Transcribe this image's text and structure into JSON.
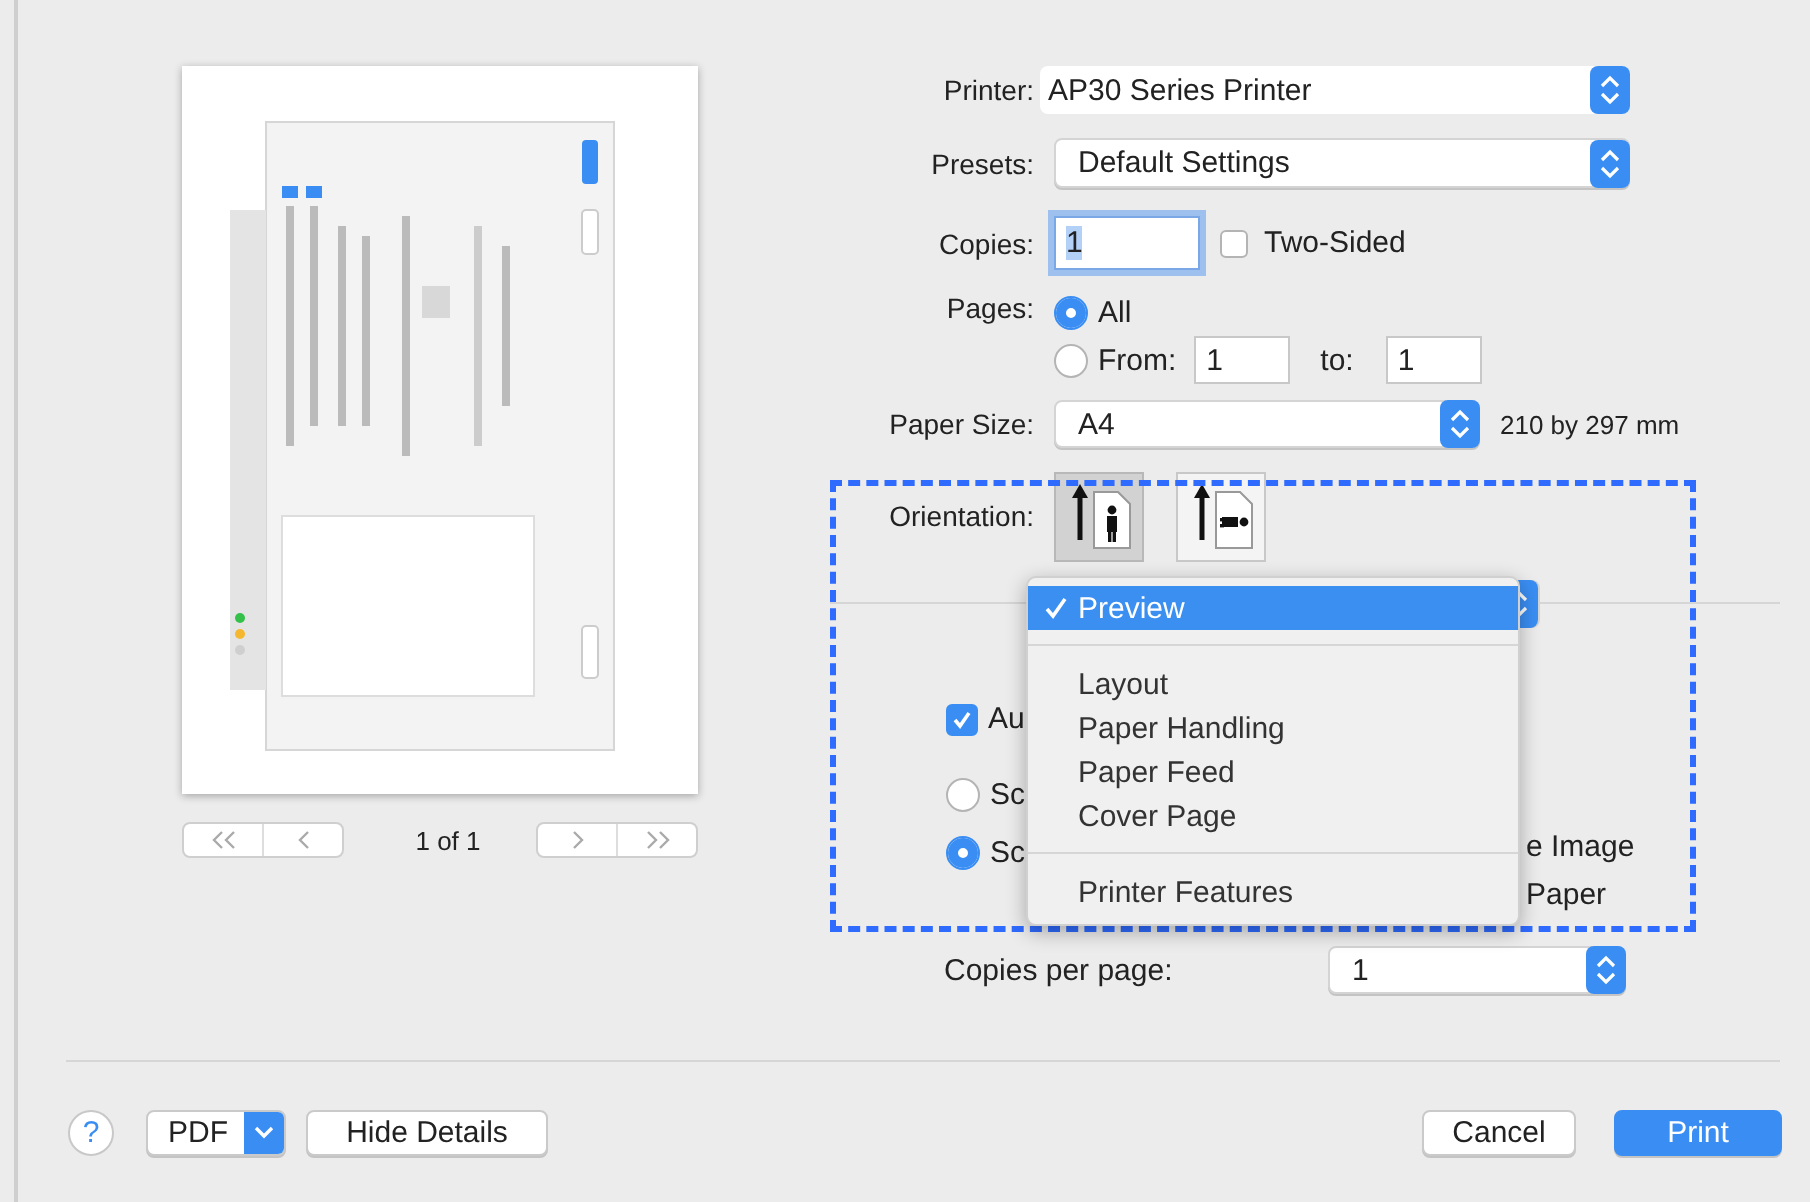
{
  "preview": {
    "page_label": "1 of 1"
  },
  "printer": {
    "label": "Printer:",
    "value": "AP30 Series Printer"
  },
  "presets": {
    "label": "Presets:",
    "value": "Default Settings"
  },
  "copies": {
    "label": "Copies:",
    "value": "1"
  },
  "two_sided": {
    "label": "Two-Sided",
    "checked": false
  },
  "pages": {
    "label": "Pages:",
    "options": [
      {
        "label": "All",
        "selected": true
      },
      {
        "label": "From:",
        "selected": false
      }
    ],
    "from": "1",
    "to_label": "to:",
    "to": "1"
  },
  "paper_size": {
    "label": "Paper Size:",
    "value": "A4",
    "dimensions": "210 by 297 mm"
  },
  "orientation": {
    "label": "Orientation:",
    "options": [
      {
        "kind": "portrait",
        "selected": true
      },
      {
        "kind": "landscape",
        "selected": false
      }
    ]
  },
  "section_menu": {
    "groups": [
      {
        "items": [
          {
            "label": "Preview",
            "selected": true
          }
        ]
      },
      {
        "items": [
          {
            "label": "Layout",
            "selected": false
          },
          {
            "label": "Paper Handling",
            "selected": false
          },
          {
            "label": "Paper Feed",
            "selected": false
          },
          {
            "label": "Cover Page",
            "selected": false
          }
        ]
      },
      {
        "items": [
          {
            "label": "Printer Features",
            "selected": false
          }
        ]
      }
    ]
  },
  "covered_options": {
    "auto": {
      "label": "Au",
      "checked": true
    },
    "scale": [
      {
        "label": "Sc",
        "selected": false
      },
      {
        "label": "Sc",
        "selected": true
      }
    ],
    "fragments": [
      "e Image",
      "Paper"
    ]
  },
  "copies_per_page": {
    "label": "Copies per page:",
    "value": "1"
  },
  "footer": {
    "help": "?",
    "pdf": "PDF",
    "hide_details": "Hide Details",
    "cancel": "Cancel",
    "print": "Print"
  }
}
